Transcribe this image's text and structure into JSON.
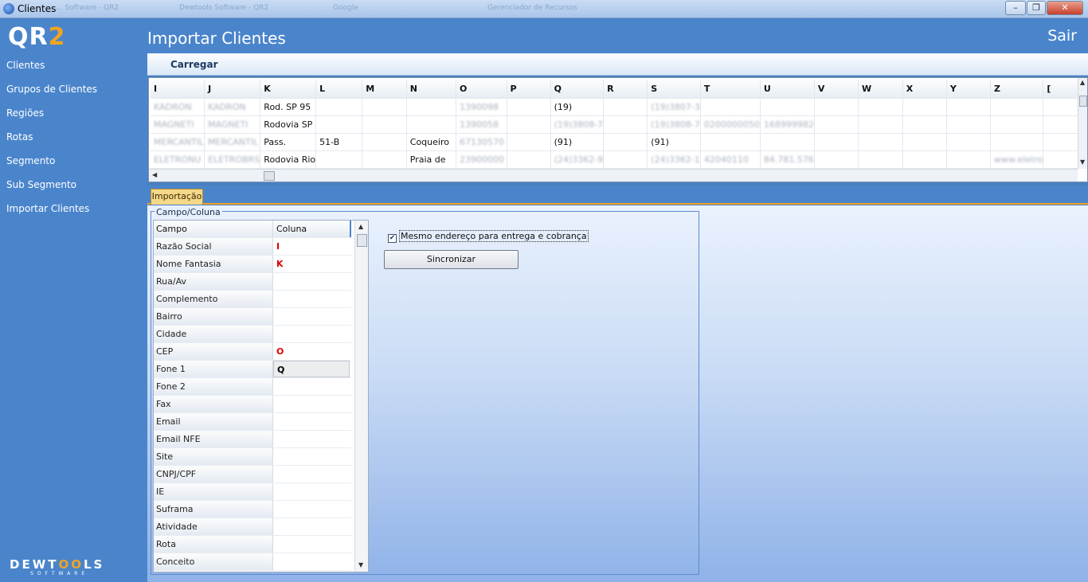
{
  "window": {
    "title": "Clientes",
    "ghost_tabs": [
      "... Software - QR2",
      "Dewtools Software - QR2",
      "Google",
      "Gerenciador de Recursos"
    ]
  },
  "sidebar": {
    "logo_main": "QR",
    "logo_accent": "2",
    "items": [
      {
        "label": "Clientes"
      },
      {
        "label": "Grupos de Clientes"
      },
      {
        "label": "Regiões"
      },
      {
        "label": "Rotas"
      },
      {
        "label": "Segmento"
      },
      {
        "label": "Sub Segmento"
      },
      {
        "label": "Importar Clientes"
      }
    ],
    "footer_brand_a": "DEWT",
    "footer_brand_b": "OO",
    "footer_brand_c": "LS",
    "footer_sub": "SOFTWARE"
  },
  "header": {
    "title": "Importar Clientes",
    "exit_label": "Sair"
  },
  "toolbar": {
    "load_label": "Carregar"
  },
  "grid": {
    "columns": [
      "I",
      "J",
      "K",
      "L",
      "M",
      "N",
      "O",
      "P",
      "Q",
      "R",
      "S",
      "T",
      "U",
      "V",
      "W",
      "X",
      "Y",
      "Z",
      "["
    ],
    "rows": [
      [
        "KADRON",
        "KADRON",
        "Rod. SP 95",
        "",
        "",
        "",
        "1390098",
        "",
        "(19)",
        "",
        "(19)3807-3",
        "",
        "",
        "",
        "",
        "",
        "",
        "",
        ""
      ],
      [
        "MAGNETI",
        "MAGNETI",
        "Rodovia SP",
        "",
        "",
        "",
        "1390058",
        "",
        "(19)3808-7",
        "",
        "(19)3808-7",
        "0200000050",
        "168999982",
        "",
        "",
        "",
        "",
        "",
        ""
      ],
      [
        "MERCANTIL",
        "MERCANTIL",
        "Pass.",
        "51-B",
        "",
        "Coqueiro",
        "67130570",
        "",
        "(91)",
        "",
        "(91)",
        "",
        "",
        "",
        "",
        "",
        "",
        "",
        ""
      ],
      [
        "ELETRONU",
        "ELETROBRS",
        "Rodovia Rio",
        "",
        "",
        "Praia de",
        "23900000",
        "",
        "(24)3362-9",
        "",
        "(24)3362-1",
        "42040110",
        "84.781.576",
        "",
        "",
        "",
        "",
        "www.eletro",
        ""
      ]
    ],
    "blurred": [
      [
        1,
        1,
        0,
        0,
        0,
        0,
        1,
        0,
        0,
        0,
        1,
        0,
        0,
        0,
        0,
        0,
        0,
        0,
        0
      ],
      [
        1,
        1,
        0,
        0,
        0,
        0,
        1,
        0,
        1,
        0,
        1,
        1,
        1,
        0,
        0,
        0,
        0,
        0,
        0
      ],
      [
        1,
        1,
        0,
        0,
        0,
        0,
        1,
        0,
        0,
        0,
        0,
        0,
        0,
        0,
        0,
        0,
        0,
        0,
        0
      ],
      [
        1,
        1,
        0,
        0,
        0,
        0,
        1,
        0,
        1,
        0,
        1,
        1,
        1,
        0,
        0,
        0,
        0,
        1,
        0
      ]
    ]
  },
  "tabs": {
    "import_label": "Importação"
  },
  "mapping": {
    "group_title": "Campo/Coluna",
    "header_field": "Campo",
    "header_column": "Coluna",
    "rows": [
      {
        "field": "Razão Social",
        "column": "I"
      },
      {
        "field": "Nome Fantasia",
        "column": "K"
      },
      {
        "field": "Rua/Av",
        "column": ""
      },
      {
        "field": "Complemento",
        "column": ""
      },
      {
        "field": "Bairro",
        "column": ""
      },
      {
        "field": "Cidade",
        "column": ""
      },
      {
        "field": "CEP",
        "column": "O"
      },
      {
        "field": "Fone 1",
        "column": "Q",
        "selected": true
      },
      {
        "field": "Fone 2",
        "column": ""
      },
      {
        "field": "Fax",
        "column": ""
      },
      {
        "field": "Email",
        "column": ""
      },
      {
        "field": "Email NFE",
        "column": ""
      },
      {
        "field": "Site",
        "column": ""
      },
      {
        "field": "CNPJ/CPF",
        "column": ""
      },
      {
        "field": "IE",
        "column": ""
      },
      {
        "field": "Suframa",
        "column": ""
      },
      {
        "field": "Atividade",
        "column": ""
      },
      {
        "field": "Rota",
        "column": ""
      },
      {
        "field": "Conceito",
        "column": ""
      }
    ]
  },
  "options": {
    "same_address_label": "Mesmo endereço para entrega e cobrança",
    "same_address_checked": true,
    "sync_label": "Sincronizar"
  }
}
